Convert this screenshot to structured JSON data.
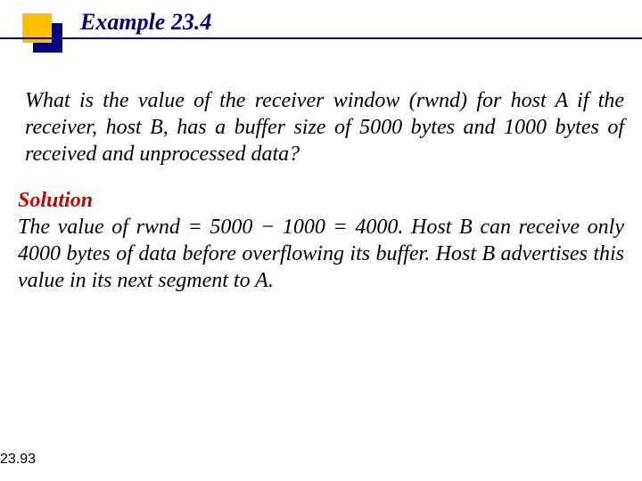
{
  "header": {
    "title": "Example 23.4"
  },
  "question": {
    "text": "What is the value of the receiver window (rwnd) for host A if the receiver, host B, has a buffer size of 5000 bytes and 1000 bytes of received and unprocessed data?"
  },
  "solution": {
    "label": "Solution",
    "text": "The value of rwnd = 5000 − 1000 = 4000. Host B can receive only 4000 bytes of data before overflowing its buffer. Host B advertises this value in its next segment to A."
  },
  "footer": {
    "slide_number": "23.93"
  }
}
